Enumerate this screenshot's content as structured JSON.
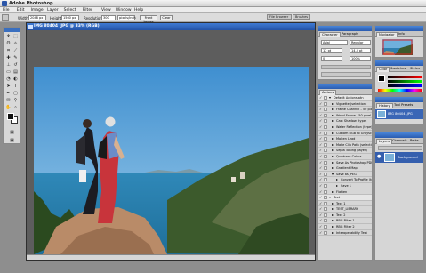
{
  "app": {
    "title": "Adobe Photoshop"
  },
  "menu": [
    "File",
    "Edit",
    "Image",
    "Layer",
    "Select",
    "Filter",
    "View",
    "Window",
    "Help"
  ],
  "options_bar": {
    "width_label": "Width:",
    "width_value": "2048 px",
    "height_label": "Height:",
    "height_value": "1560 px",
    "resolution_label": "Resolution:",
    "resolution_value": "300",
    "resolution_unit": "pixels/inch",
    "front_image": "Front Image",
    "clear": "Clear"
  },
  "palette_well": {
    "tabs": [
      "File Browser",
      "Brushes"
    ]
  },
  "document": {
    "title": "IMG 80404 .JPG @ 33% (RGB)"
  },
  "character_panel": {
    "tabs": [
      "Character",
      "Paragraph"
    ],
    "font": "Arial",
    "style": "Regular",
    "size": "12 pt",
    "leading": "14.4 pt",
    "tracking": "0",
    "scale": "100%"
  },
  "navigator_panel": {
    "tabs": [
      "Navigator",
      "Info"
    ],
    "zoom": "33.33%"
  },
  "color_panel": {
    "tabs": [
      "Color",
      "Swatches",
      "Styles"
    ]
  },
  "history_panel": {
    "tabs": [
      "History",
      "Tool Presets"
    ],
    "snapshot": "IMG 80404 .JPG"
  },
  "layers_panel": {
    "tabs": [
      "Layers",
      "Channels",
      "Paths"
    ],
    "layer_name": "Background"
  },
  "actions_panel": {
    "tab": "Actions",
    "items": [
      {
        "name": "Default Actions.atn",
        "type": "folder",
        "checked": true
      },
      {
        "name": "Vignette (selection)",
        "type": "action",
        "checked": true
      },
      {
        "name": "Frame Channel - 50 pixel",
        "type": "action",
        "checked": true
      },
      {
        "name": "Wood Frame - 50 pixel",
        "type": "action",
        "checked": true
      },
      {
        "name": "Cast Shadow (type)",
        "type": "action",
        "checked": true
      },
      {
        "name": "Water Reflection (type)",
        "type": "action",
        "checked": true
      },
      {
        "name": "Custom RGB to Grayscale",
        "type": "action",
        "checked": true
      },
      {
        "name": "Molten Lead",
        "type": "action",
        "checked": true
      },
      {
        "name": "Make Clip Path (selection)",
        "type": "action",
        "checked": true
      },
      {
        "name": "Sepia Toning (layer)",
        "type": "action",
        "checked": true
      },
      {
        "name": "Quadrant Colors",
        "type": "action",
        "checked": true
      },
      {
        "name": "Save As Photoshop PDF",
        "type": "action",
        "checked": true
      },
      {
        "name": "Gradient Map",
        "type": "action",
        "checked": true
      },
      {
        "name": "Save as JPEG",
        "type": "action",
        "checked": true,
        "open": true
      },
      {
        "name": "Convert To Profile (to...",
        "type": "step",
        "checked": true
      },
      {
        "name": "Save 1",
        "type": "step",
        "checked": true
      },
      {
        "name": "Flatten",
        "type": "action",
        "checked": true
      },
      {
        "name": "Text",
        "type": "folder",
        "checked": true
      },
      {
        "name": "Text 1",
        "type": "action",
        "checked": true
      },
      {
        "name": "TEST_LIBRARY",
        "type": "action",
        "checked": true
      },
      {
        "name": "Text 2",
        "type": "action",
        "checked": true
      },
      {
        "name": "RBG Filter 1",
        "type": "action",
        "checked": true
      },
      {
        "name": "RBG Filter 2",
        "type": "action",
        "checked": true
      },
      {
        "name": "Interoperability Test",
        "type": "action",
        "checked": true
      }
    ]
  },
  "colors": {
    "titlebar_blue": "#2453a6",
    "panel_bg": "#d6d6d6",
    "workspace": "#8e8e8e"
  }
}
